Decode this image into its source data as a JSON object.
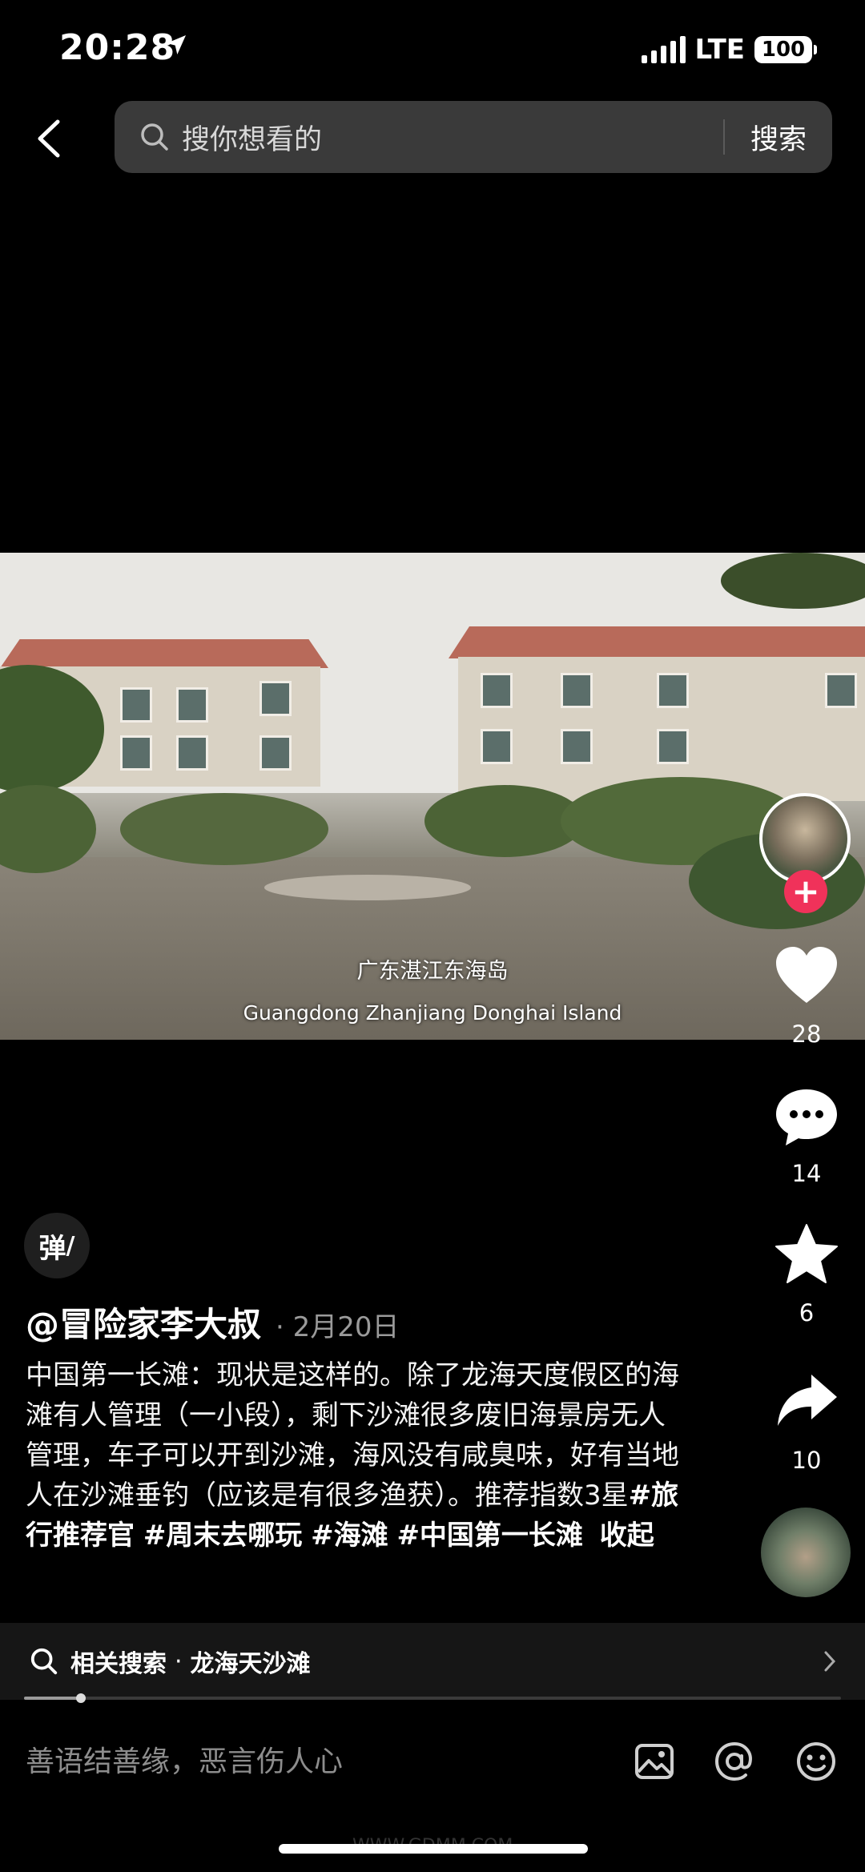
{
  "status_bar": {
    "time": "20:28",
    "network": "LTE",
    "battery": "100"
  },
  "search": {
    "placeholder": "搜你想看的",
    "button_label": "搜索"
  },
  "video": {
    "subtitle_cn": "广东湛江东海岛",
    "subtitle_en": "Guangdong Zhanjiang Donghai Island"
  },
  "rail": {
    "likes": "28",
    "comments": "14",
    "favorites": "6",
    "shares": "10",
    "follow_symbol": "+"
  },
  "danmu_label": "弹",
  "post": {
    "author": "@冒险家李大叔",
    "date": "· 2月20日",
    "caption_text": "中国第一长滩：现状是这样的。除了龙海天度假区的海滩有人管理（一小段），剩下沙滩很多废旧海景房无人管理，车子可以开到沙滩，海风没有咸臭味，好有当地人在沙滩垂钓（应该是有很多渔获）。推荐指数3星",
    "tags": [
      "#旅行推荐官",
      "#周末去哪玩",
      "#海滩",
      "#中国第一长滩"
    ],
    "collapse_label": "收起"
  },
  "related_search": {
    "label": "相关搜索",
    "separator": "·",
    "term": "龙海天沙滩"
  },
  "playback_progress": 0.07,
  "comment_bar": {
    "placeholder": "善语结善缘，恶言伤人心"
  },
  "watermark": "WWW.GDMM.COM",
  "colors": {
    "follow_accent": "#f0325a",
    "background": "#000000",
    "search_box": "#3a3a3a"
  },
  "icons": [
    "back-arrow-icon",
    "search-icon",
    "heart-icon",
    "comment-icon",
    "star-icon",
    "share-icon",
    "image-icon",
    "at-icon",
    "emoji-icon",
    "chevron-right-icon",
    "location-arrow-icon"
  ]
}
